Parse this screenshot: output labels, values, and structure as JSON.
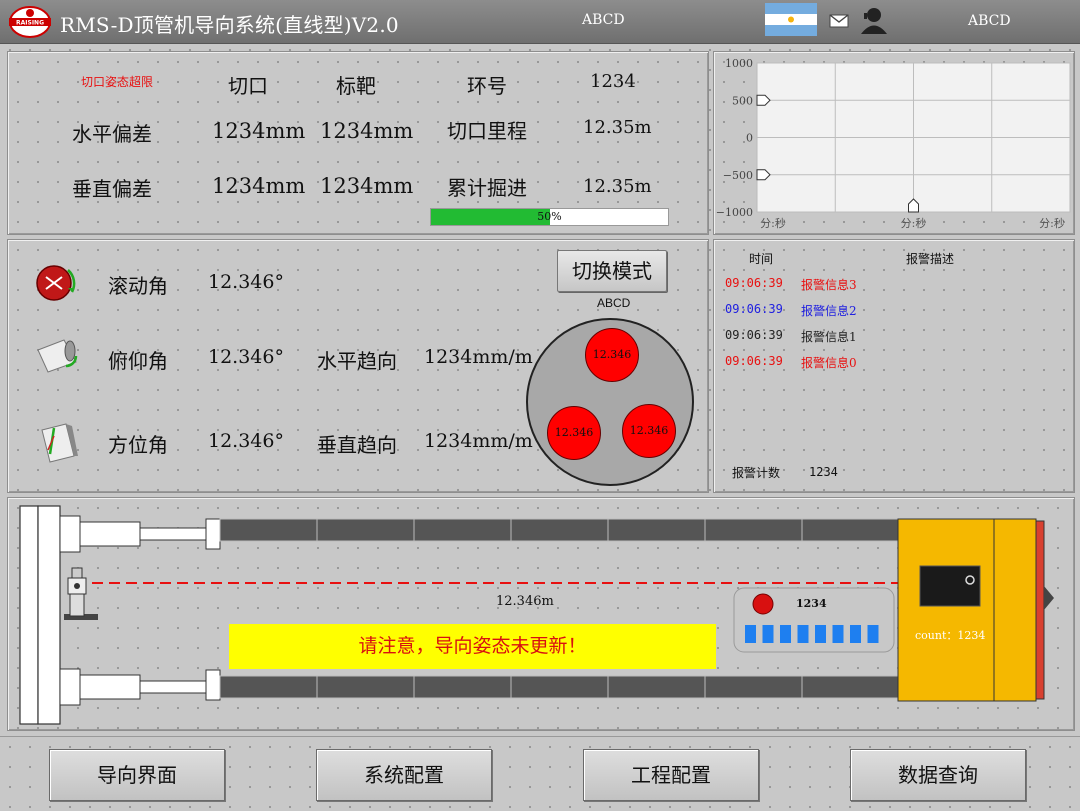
{
  "header": {
    "title": "RMS-D顶管机导向系统(直线型)V2.0",
    "logo_text": "RAISING",
    "label_1": "ABCD",
    "label_2": "ABCD",
    "flag_icon": "argentina-flag-icon",
    "mail_icon": "mail-icon",
    "user_icon": "user-icon"
  },
  "guidance": {
    "warning": "切口姿态超限",
    "col_cut": "切口",
    "col_target": "标靶",
    "ring_label": "环号",
    "ring_value": "1234",
    "horizontal_label": "水平偏差",
    "horizontal_cut": "1234mm",
    "horizontal_target": "1234mm",
    "mileage_label": "切口里程",
    "mileage_value": "12.35m",
    "vertical_label": "垂直偏差",
    "vertical_cut": "1234mm",
    "vertical_target": "1234mm",
    "advance_label": "累计掘进",
    "advance_value": "12.35m",
    "progress_percent": 50,
    "progress_text": "50%"
  },
  "chart_data": {
    "type": "line",
    "y_ticks": [
      "1000",
      "500",
      "0",
      "−500",
      "−1000"
    ],
    "ylim": [
      -1000,
      1000
    ],
    "x_ticks": [
      "分:秒",
      "分:秒",
      "分:秒"
    ],
    "grid": true,
    "markers": [
      {
        "axis": "y",
        "value": 500
      },
      {
        "axis": "y",
        "value": -500
      },
      {
        "axis": "x",
        "value": 0.5
      }
    ]
  },
  "attitude": {
    "roll_label": "滚动角",
    "roll_value": "12.346°",
    "pitch_label": "俯仰角",
    "pitch_value": "12.346°",
    "azimuth_label": "方位角",
    "azimuth_value": "12.346°",
    "h_trend_label": "水平趋向",
    "h_trend_value": "1234mm/m",
    "v_trend_label": "垂直趋向",
    "v_trend_value": "1234mm/m",
    "switch_mode_label": "切换模式",
    "circle_label": "ABCD",
    "dot_top": "12.346",
    "dot_left": "12.346",
    "dot_right": "12.346"
  },
  "alarms": {
    "time_header": "时间",
    "desc_header": "报警描述",
    "rows": [
      {
        "time": "09:06:39",
        "desc": "报警信息3",
        "color": "#e81010"
      },
      {
        "time": "09:06:39",
        "desc": "报警信息2",
        "color": "#2020e0"
      },
      {
        "time": "09:06:39",
        "desc": "报警信息1",
        "color": "#222222"
      },
      {
        "time": "09:06:39",
        "desc": "报警信息0",
        "color": "#e81010"
      }
    ],
    "count_label": "报警计数",
    "count_value": "1234"
  },
  "machine": {
    "distance": "12.346m",
    "notice": "请注意，导向姿态未更新！",
    "indicator_value": "1234",
    "count_text": "count：1234",
    "bar_segments": 8
  },
  "nav": {
    "items": [
      "导向界面",
      "系统配置",
      "工程配置",
      "数据查询"
    ]
  },
  "colors": {
    "accent_red": "#ff0000",
    "progress_green": "#22bb33",
    "notice_yellow": "#ffff00",
    "machine_orange": "#f5b800",
    "segment_blue": "#1e7ff0"
  }
}
